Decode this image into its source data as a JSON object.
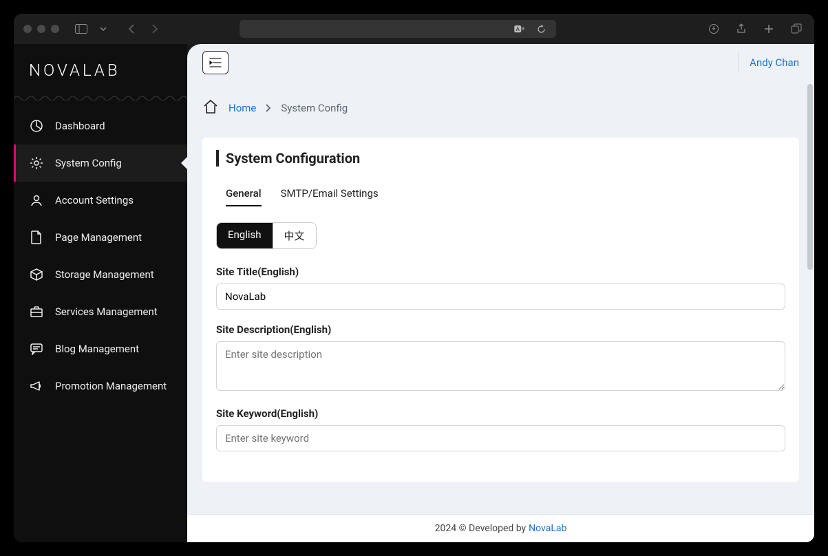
{
  "brand": "NOVALAB",
  "user_name": "Andy Chan",
  "breadcrumb": {
    "home": "Home",
    "current": "System Config"
  },
  "sidebar": {
    "items": [
      {
        "label": "Dashboard",
        "icon": "pie-chart"
      },
      {
        "label": "System Config",
        "icon": "gear"
      },
      {
        "label": "Account Settings",
        "icon": "user"
      },
      {
        "label": "Page Management",
        "icon": "file"
      },
      {
        "label": "Storage Management",
        "icon": "box"
      },
      {
        "label": "Services Management",
        "icon": "briefcase"
      },
      {
        "label": "Blog Management",
        "icon": "message"
      },
      {
        "label": "Promotion Management",
        "icon": "megaphone"
      }
    ],
    "active_index": 1
  },
  "page_title": "System Configuration",
  "tabs": {
    "items": [
      "General",
      "SMTP/Email Settings"
    ],
    "active_index": 0
  },
  "lang_pills": {
    "items": [
      "English",
      "中文"
    ],
    "active_index": 0
  },
  "form": {
    "site_title": {
      "label": "Site Title(English)",
      "value": "NovaLab",
      "placeholder": ""
    },
    "site_description": {
      "label": "Site Description(English)",
      "value": "",
      "placeholder": "Enter site description"
    },
    "site_keyword": {
      "label": "Site Keyword(English)",
      "value": "",
      "placeholder": "Enter site keyword"
    }
  },
  "footer": {
    "text": "2024 © Developed by",
    "link": "NovaLab"
  }
}
